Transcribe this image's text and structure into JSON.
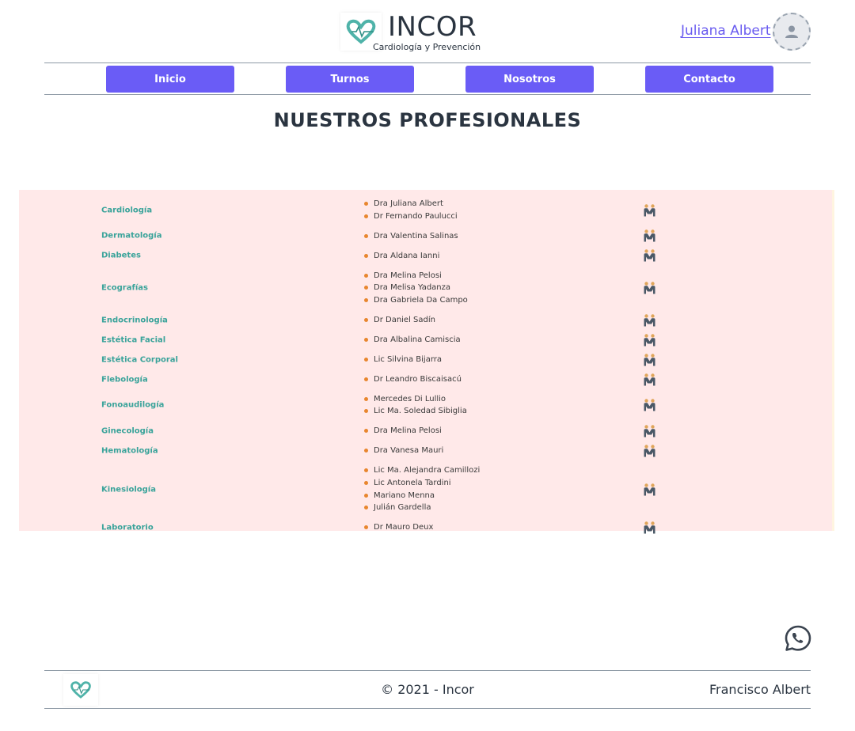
{
  "header": {
    "brand_title": "INCOR",
    "brand_subtitle": "Cardiología y Prevención",
    "user_name": "Juliana Albert"
  },
  "nav": {
    "items": [
      {
        "label": "Inicio"
      },
      {
        "label": "Turnos"
      },
      {
        "label": "Nosotros"
      },
      {
        "label": "Contacto"
      }
    ]
  },
  "page": {
    "title": "NUESTROS PROFESIONALES"
  },
  "specialties": [
    {
      "name": "Cardiología",
      "doctors": [
        "Dra Juliana Albert",
        "Dr Fernando Paulucci"
      ]
    },
    {
      "name": "Dermatología",
      "doctors": [
        "Dra Valentina Salinas"
      ]
    },
    {
      "name": "Diabetes",
      "doctors": [
        "Dra Aldana Ianni"
      ]
    },
    {
      "name": "Ecografías",
      "doctors": [
        "Dra Melina Pelosi",
        "Dra Melisa Yadanza",
        "Dra Gabriela Da Campo"
      ]
    },
    {
      "name": "Endocrinología",
      "doctors": [
        "Dr Daniel Sadín"
      ]
    },
    {
      "name": "Estética Facial",
      "doctors": [
        "Dra Albalina Camiscia"
      ]
    },
    {
      "name": "Estética Corporal",
      "doctors": [
        "Lic Silvina Bijarra"
      ]
    },
    {
      "name": "Flebología",
      "doctors": [
        "Dr Leandro Biscaisacú"
      ]
    },
    {
      "name": "Fonoaudilogía",
      "doctors": [
        "Mercedes Di Lullio",
        "Lic Ma. Soledad Sibiglia"
      ]
    },
    {
      "name": "Ginecología",
      "doctors": [
        "Dra Melina Pelosi"
      ]
    },
    {
      "name": "Hematología",
      "doctors": [
        "Dra Vanesa Mauri"
      ]
    },
    {
      "name": "Kinesiología",
      "doctors": [
        "Lic Ma. Alejandra Camillozi",
        "Lic Antonela Tardini",
        "Mariano Menna",
        "Julián Gardella"
      ]
    },
    {
      "name": "Laboratorio",
      "doctors": [
        "Dr Mauro Deux"
      ]
    }
  ],
  "icons": {
    "professional": "professionals-icon",
    "whatsapp": "whatsapp-icon",
    "logo": "heart-logo-icon",
    "avatar": "user-icon"
  },
  "colors": {
    "accent": "#6a5cf6",
    "specialty": "#3aa39a",
    "bullet": "#e8862e",
    "panel": "#ffe9e9",
    "logo": "#4fb3a9"
  },
  "footer": {
    "copyright": "© 2021 - Incor",
    "author": "Francisco Albert"
  }
}
